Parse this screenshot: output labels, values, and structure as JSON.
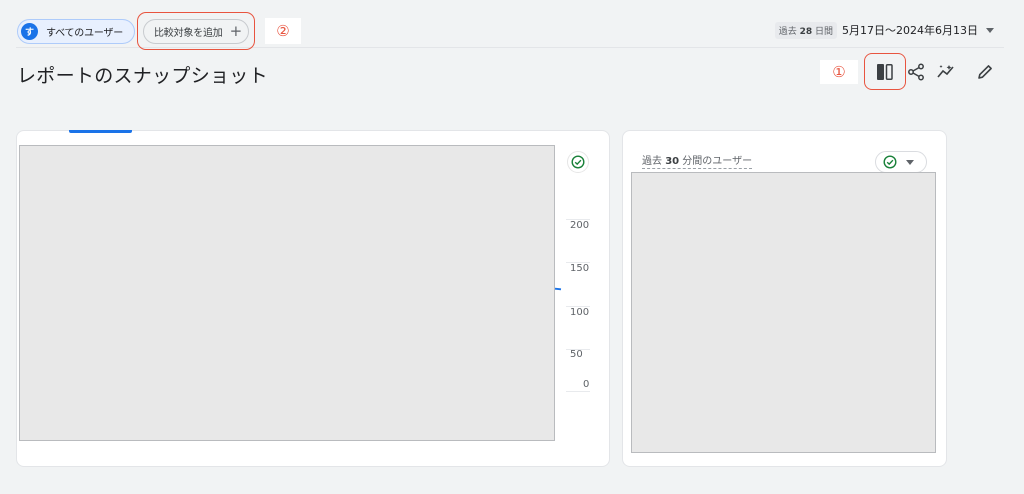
{
  "header": {
    "segment_chip": {
      "avatar_letter": "す",
      "label": "すべてのユーザー"
    },
    "compare_chip": {
      "label": "比較対象を追加",
      "plus": "+"
    },
    "annotation_2": "②",
    "date_range": {
      "pill_prefix": "過去",
      "pill_days": "28",
      "pill_suffix": "日間",
      "range_text": "5月17日～2024年6月13日"
    }
  },
  "page": {
    "title": "レポートのスナップショット"
  },
  "toolbar": {
    "annotation_1": "①",
    "icons": [
      "customize-report-icon",
      "share-icon",
      "insights-icon",
      "edit-icon"
    ]
  },
  "main_card": {
    "y_ticks": [
      "200",
      "150",
      "100",
      "50",
      "0"
    ],
    "check_icon": "check-circle-icon"
  },
  "realtime_card": {
    "label_prefix": "過去",
    "label_number": "30",
    "label_suffix": "分間のユーザー"
  },
  "colors": {
    "accent": "#1a73e8",
    "annotation": "#e8543f",
    "check": "#188038"
  }
}
